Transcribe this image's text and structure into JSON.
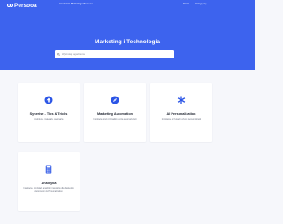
{
  "header": {
    "logo_text": "Persooa",
    "subtitle": "Academia Marketingu Persooa",
    "nav": {
      "portal": "Portal",
      "login": "Zaloguj się"
    }
  },
  "hero": {
    "title": "Marketing i Technologia",
    "search_placeholder": "Wyszukaj zagadnienia"
  },
  "accent_color": "#3d63ee",
  "cards": [
    {
      "title": "Synerise - Tips & Tricks",
      "description": "Instrukcje, materiały, webinaria",
      "icon": "arrow-up-circle-icon"
    },
    {
      "title": "Marketing Automation",
      "description": "Inspiracje oraz przypadki użycia automatyzacji",
      "icon": "compass-icon"
    },
    {
      "title": "AI Personalization",
      "description": "Inspiracje, przypadki użycia personalizacji",
      "icon": "asterisk-icon"
    },
    {
      "title": "Analityka",
      "description": "Inspiracje, przykłady analityki i raportów dla Marketing Automation & Personalization",
      "icon": "calculator-icon"
    }
  ]
}
